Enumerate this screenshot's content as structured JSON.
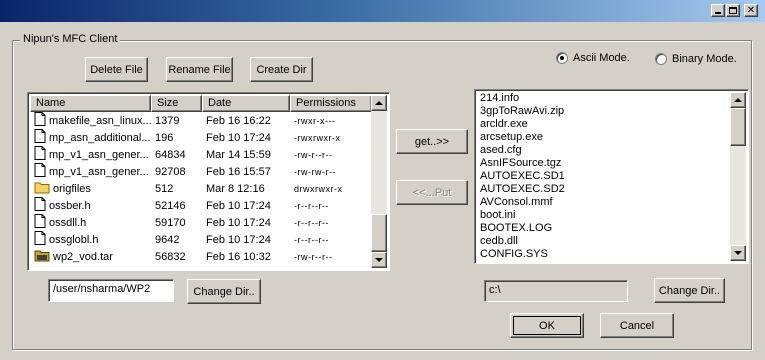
{
  "window": {
    "title": ""
  },
  "group": {
    "label": "Nipun's MFC Client"
  },
  "toolbar": {
    "delete_file": "Delete File",
    "rename_file": "Rename File",
    "create_dir": "Create Dir"
  },
  "mode": {
    "ascii": "Ascii Mode.",
    "binary": "Binary Mode.",
    "selected": "ascii"
  },
  "remote": {
    "columns": [
      "Name",
      "Size",
      "Date",
      "Permissions"
    ],
    "rows": [
      {
        "icon": "file-icon",
        "name": "makefile_asn_linux...",
        "size": "1379",
        "date": "Feb 16 16:22",
        "perm": "-rwxr-x---"
      },
      {
        "icon": "file-icon",
        "name": "mp_asn_additional...",
        "size": "196",
        "date": "Feb 10 17:24",
        "perm": "-rwxrwxr-x"
      },
      {
        "icon": "file-icon",
        "name": "mp_v1_asn_gener...",
        "size": "64834",
        "date": "Mar 14 15:59",
        "perm": "-rw-r--r--"
      },
      {
        "icon": "file-icon",
        "name": "mp_v1_asn_gener...",
        "size": "92708",
        "date": "Feb 16 15:57",
        "perm": "-rw-rw-r--"
      },
      {
        "icon": "folder-icon",
        "name": "origfiles",
        "size": "512",
        "date": "Mar 8 12:16",
        "perm": "drwxrwxr-x"
      },
      {
        "icon": "file-icon",
        "name": "ossber.h",
        "size": "52146",
        "date": "Feb 10 17:24",
        "perm": "-r--r--r--"
      },
      {
        "icon": "file-icon",
        "name": "ossdll.h",
        "size": "59170",
        "date": "Feb 10 17:24",
        "perm": "-r--r--r--"
      },
      {
        "icon": "file-icon",
        "name": "ossglobl.h",
        "size": "9642",
        "date": "Feb 10 17:24",
        "perm": "-r--r--r--"
      },
      {
        "icon": "archive-icon",
        "name": "wp2_vod.tar",
        "size": "56832",
        "date": "Feb 16 10:32",
        "perm": "-rw-r--r--"
      }
    ],
    "path": "/user/nsharma/WP2",
    "change_dir": "Change Dir.."
  },
  "transfer": {
    "get": "get..>>",
    "put": "<<...Put"
  },
  "local": {
    "items": [
      "214.info",
      "3gpToRawAvi.zip",
      "arcldr.exe",
      "arcsetup.exe",
      "ased.cfg",
      "AsnIFSource.tgz",
      "AUTOEXEC.SD1",
      "AUTOEXEC.SD2",
      "AVConsol.mmf",
      "boot.ini",
      "BOOTEX.LOG",
      "cedb.dll",
      "CONFIG.SYS"
    ],
    "path": "c:\\",
    "change_dir": "Change Dir.."
  },
  "dialog": {
    "ok": "OK",
    "cancel": "Cancel"
  }
}
